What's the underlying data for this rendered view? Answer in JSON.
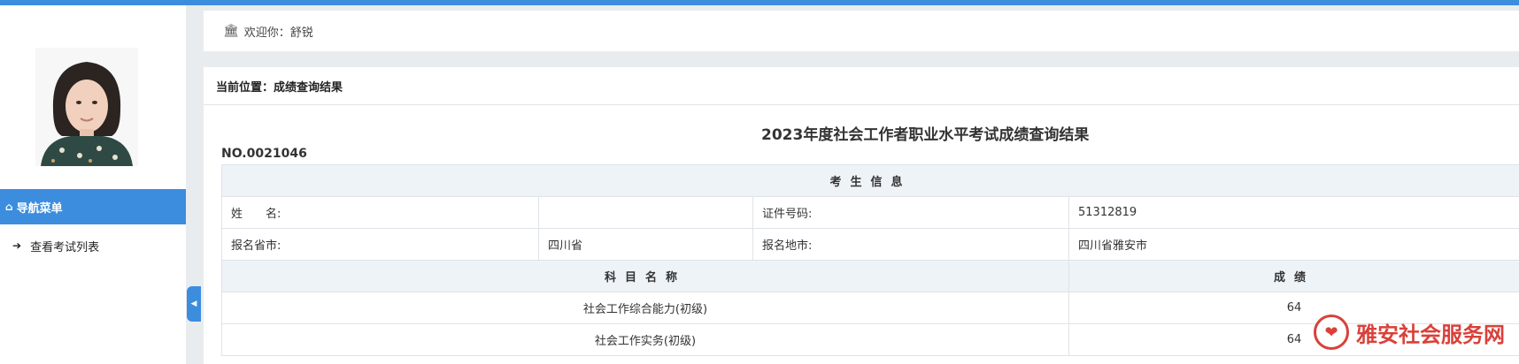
{
  "welcome": {
    "icon": "bank-icon",
    "text": "欢迎你：舒锐"
  },
  "sidebar": {
    "nav_header": {
      "icon": "home-icon",
      "label": "导航菜单"
    },
    "items": [
      {
        "icon": "sign-in-icon",
        "label": "查看考试列表"
      }
    ],
    "collapse_icon": "caret-left-icon"
  },
  "breadcrumb": "当前位置：成绩查询结果",
  "report": {
    "title": "2023年度社会工作者职业水平考试成绩查询结果",
    "number": "NO.0021046",
    "section_title": "考生信息",
    "rows": [
      {
        "label1": "姓　　名:",
        "value1": "",
        "label2": "证件号码:",
        "value2": "51312819"
      },
      {
        "label1": "报名省市:",
        "value1": "四川省",
        "label2": "报名地市:",
        "value2": "四川省雅安市"
      }
    ],
    "scores_header": {
      "subject": "科目名称",
      "score": "成绩"
    },
    "scores": [
      {
        "subject": "社会工作综合能力(初级)",
        "score": "64"
      },
      {
        "subject": "社会工作实务(初级)",
        "score": "64"
      }
    ]
  },
  "watermark": {
    "text": "雅安社会服务网"
  },
  "colors": {
    "accent": "#3c8dde",
    "header_bg": "#eef3f8",
    "watermark": "#d9413a"
  }
}
